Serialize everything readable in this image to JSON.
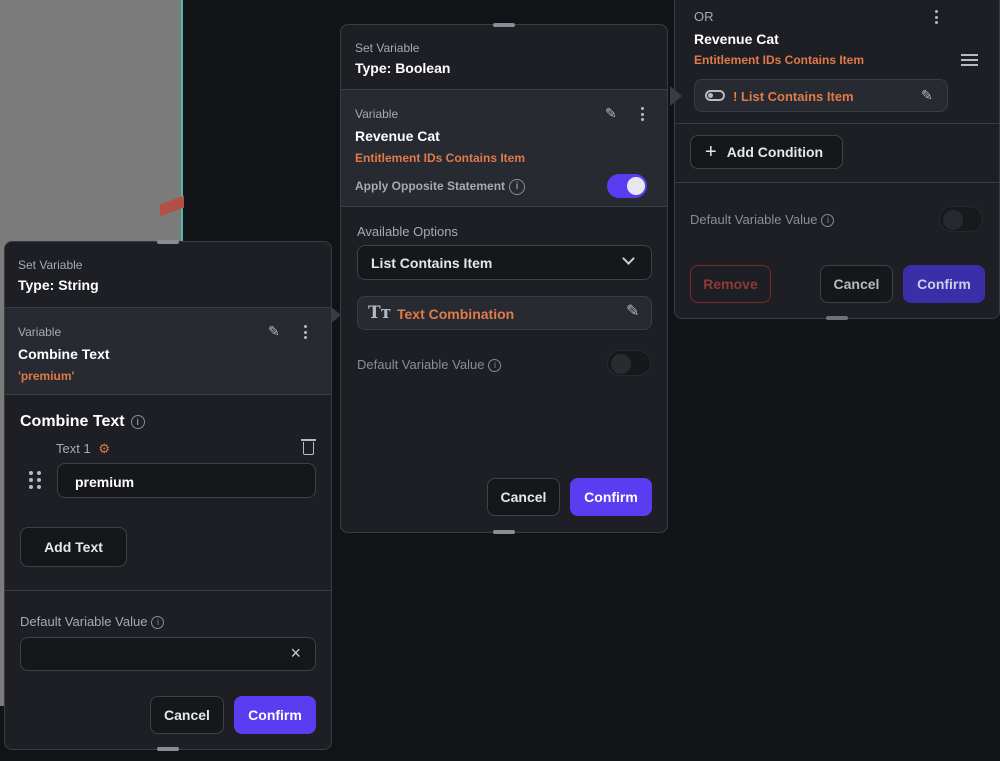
{
  "left_panel": {
    "header_small": "Set Variable",
    "header_type": "Type: String",
    "variable_label": "Variable",
    "variable_name": "Combine Text",
    "variable_value": "'premium'",
    "section_title": "Combine Text",
    "text_item_label": "Text 1",
    "text_item_value": "premium",
    "add_text_label": "Add Text",
    "default_label": "Default Variable Value",
    "default_value": "",
    "cancel_label": "Cancel",
    "confirm_label": "Confirm"
  },
  "middle_panel": {
    "header_small": "Set Variable",
    "header_type": "Type: Boolean",
    "variable_label": "Variable",
    "variable_name": "Revenue Cat",
    "variable_value": "Entitlement IDs Contains Item",
    "opposite_label": "Apply Opposite Statement",
    "opposite_enabled": true,
    "options_label": "Available Options",
    "selected_option": "List Contains Item",
    "text_combination_label": "Text Combination",
    "default_label": "Default Variable Value",
    "default_enabled": false,
    "cancel_label": "Cancel",
    "confirm_label": "Confirm"
  },
  "right_panel": {
    "or_label": "OR",
    "condition_name": "Revenue Cat",
    "condition_value": "Entitlement IDs Contains Item",
    "condition_chip": "! List Contains Item",
    "add_condition_label": "Add Condition",
    "default_label": "Default Variable Value",
    "default_enabled": false,
    "remove_label": "Remove",
    "cancel_label": "Cancel",
    "confirm_label": "Confirm"
  },
  "colors": {
    "accent": "#5b3cf0",
    "orange": "#e07a4a",
    "panel_bg": "#1d1f24",
    "page_bg": "#121316"
  }
}
